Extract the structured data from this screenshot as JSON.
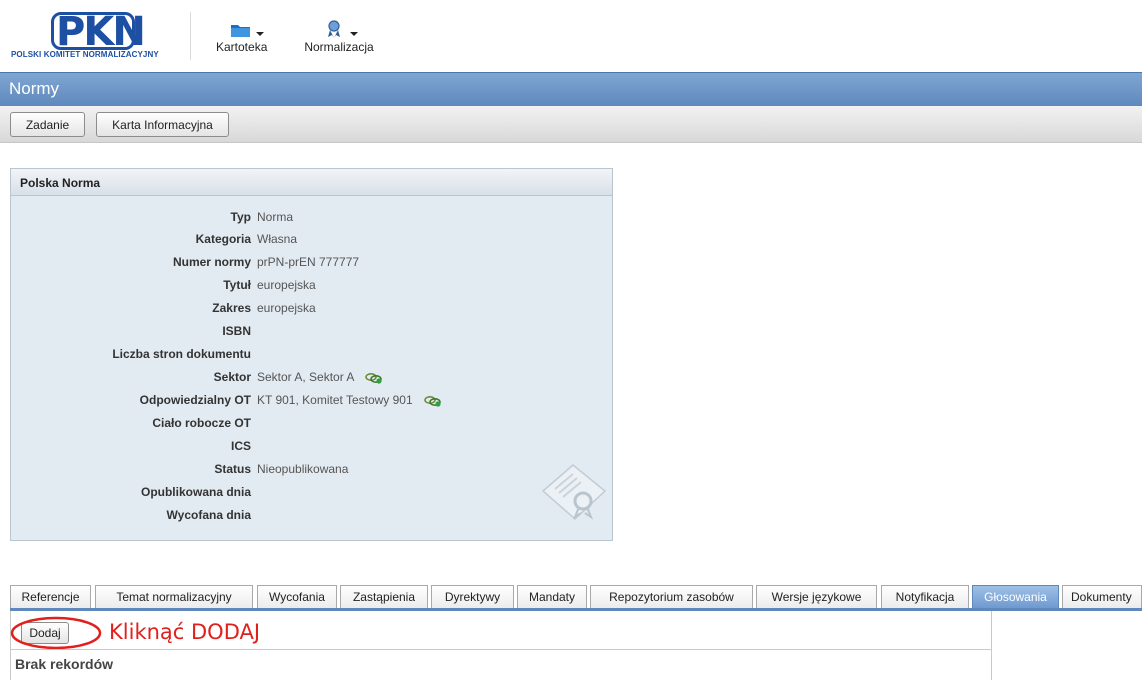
{
  "logo": {
    "mark": "PKN",
    "name": "POLSKI KOMITET NORMALIZACYJNY"
  },
  "nav": [
    {
      "label": "Kartoteka",
      "icon": "folder-icon"
    },
    {
      "label": "Normalizacja",
      "icon": "ribbon-badge-icon"
    }
  ],
  "page_title": "Normy",
  "toolbar": {
    "zadanie": "Zadanie",
    "karta": "Karta Informacyjna"
  },
  "panel": {
    "title": "Polska Norma",
    "rows": [
      {
        "label": "Typ",
        "value": "Norma"
      },
      {
        "label": "Kategoria",
        "value": "Własna"
      },
      {
        "label": "Numer normy",
        "value": "prPN-prEN 777777"
      },
      {
        "label": "Tytuł",
        "value": "europejska"
      },
      {
        "label": "Zakres",
        "value": "europejska"
      },
      {
        "label": "ISBN",
        "value": ""
      },
      {
        "label": "Liczba stron dokumentu",
        "value": ""
      },
      {
        "label": "Sektor",
        "value": "Sektor A, Sektor A"
      },
      {
        "label": "Odpowiedzialny OT",
        "value": "KT 901, Komitet Testowy 901"
      },
      {
        "label": "Ciało robocze OT",
        "value": ""
      },
      {
        "label": "ICS",
        "value": ""
      },
      {
        "label": "Status",
        "value": "Nieopublikowana"
      },
      {
        "label": "Opublikowana dnia",
        "value": ""
      },
      {
        "label": "Wycofana dnia",
        "value": ""
      }
    ]
  },
  "tabs": [
    "Referencje",
    "Temat normalizacyjny",
    "Wycofania",
    "Zastąpienia",
    "Dyrektywy",
    "Mandaty",
    "Repozytorium zasobów",
    "Wersje językowe",
    "Notyfikacja",
    "Głosowania",
    "Dokumenty"
  ],
  "active_tab": "Głosowania",
  "tab_content": {
    "add_button": "Dodaj",
    "annotation": "Kliknąć DODAJ",
    "empty_message": "Brak rekordów"
  },
  "colors": {
    "accent": "#5f89bd",
    "annotation": "#e0201c",
    "brand": "#1d4fa3"
  }
}
